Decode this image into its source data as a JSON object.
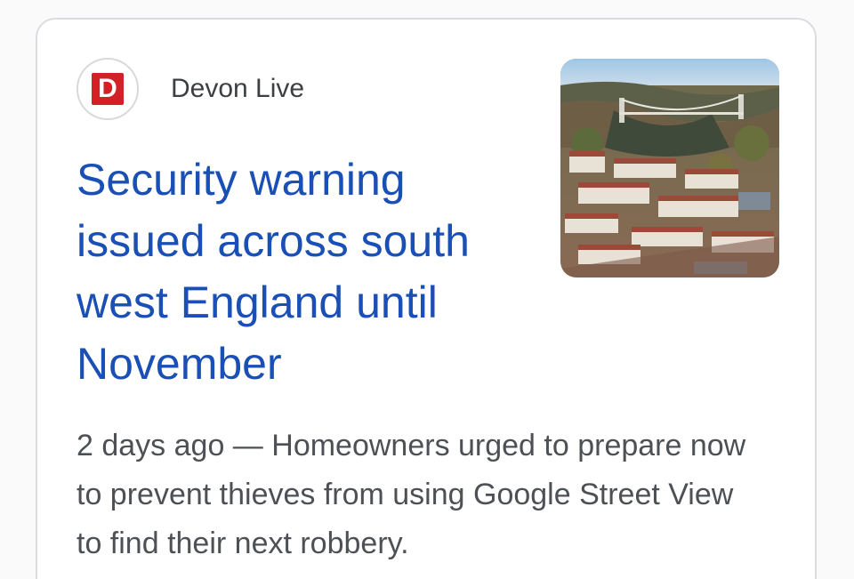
{
  "source": {
    "favicon_letter": "D",
    "favicon_color": "#d32026",
    "name": "Devon Live"
  },
  "headline": "Security warning issued across south west England until November",
  "snippet": {
    "age": "2 days ago",
    "separator": " — ",
    "text": "Homeowners urged to prepare now to prevent thieves from using Google Street View to find their next robbery."
  },
  "thumbnail": {
    "icon": "aerial-city-bridge-photo"
  },
  "colors": {
    "headline": "#1a4fb5",
    "source_text": "#3c4043",
    "snippet_text": "#4d5156",
    "card_border": "#dadce0"
  }
}
